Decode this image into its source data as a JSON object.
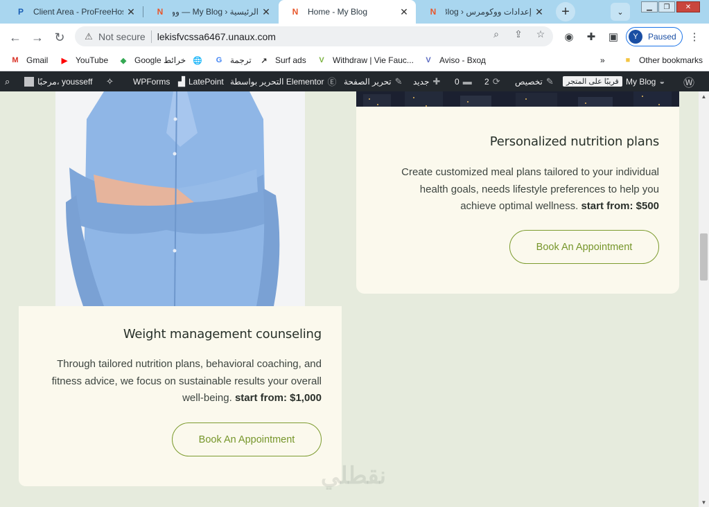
{
  "browser": {
    "tabs": [
      {
        "title": "Client Area - ProFreeHost",
        "active": false
      },
      {
        "title": "الرئيسية ‹ My Blog — وورد",
        "active": false
      },
      {
        "title": "Home - My Blog",
        "active": true
      },
      {
        "title": "إعدادات ووكومرس ‹ My Blog",
        "active": false
      }
    ],
    "new_tab_symbol": "+",
    "address": {
      "security_label": "Not secure",
      "url": "lekisfvcssa6467.unaux.com"
    },
    "profile": {
      "initial": "Y",
      "status": "Paused"
    },
    "bookmarks": [
      {
        "label": "Gmail",
        "icon": "gmail-icon"
      },
      {
        "label": "YouTube",
        "icon": "youtube-icon"
      },
      {
        "label": "Google خرائط",
        "icon": "maps-icon"
      },
      {
        "label": "",
        "icon": "globe-icon"
      },
      {
        "label": "ترجمة",
        "icon": "translate-icon"
      },
      {
        "label": "Surf ads",
        "icon": "surf-icon"
      },
      {
        "label": "Withdraw | Vie Fauc...",
        "icon": "vie-icon"
      },
      {
        "label": "Aviso - Вход",
        "icon": "aviso-icon"
      }
    ],
    "bookmarks_overflow": "»",
    "other_bookmarks": "Other bookmarks"
  },
  "adminbar": {
    "site_name": "My Blog",
    "visit_store": "قريبًا على المتجر",
    "customize": "تخصيص",
    "updates_count": "2",
    "comments_count": "0",
    "new_label": "جديد",
    "edit_page": "تحرير الصفحة",
    "edit_elementor": "التحرير بواسطة Elementor",
    "latepoint": "LatePoint",
    "wpforms": "WPForms",
    "greeting": "مرحبًا، yousseff"
  },
  "services": [
    {
      "title": "Personalized nutrition plans",
      "description": "Create customized meal plans tailored to your individual health goals, needs lifestyle preferences to help you achieve optimal wellness.",
      "price_label": "start from: $500",
      "button_label": "Book An Appointment"
    },
    {
      "title": "Weight management counseling",
      "description": "Through tailored nutrition plans, behavioral coaching, and fitness advice, we focus on sustainable results your overall well-being.",
      "price_label": "start from: $1,000",
      "button_label": "Book An Appointment"
    }
  ],
  "watermark": "نقطلي",
  "colors": {
    "tabstrip": "#a9d6ef",
    "adminbar": "#23282d",
    "page_bg": "#e6ebdd",
    "card_bg": "#fbf9ed",
    "accent": "#76962b"
  }
}
